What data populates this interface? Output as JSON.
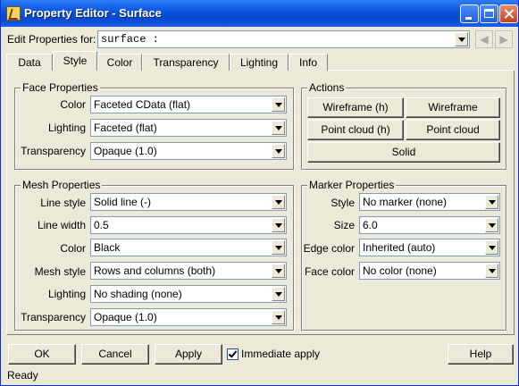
{
  "window": {
    "title": "Property Editor - Surface"
  },
  "header": {
    "edit_label": "Edit Properties for:",
    "target_value": "surface :"
  },
  "tabs": [
    "Data",
    "Style",
    "Color",
    "Transparency",
    "Lighting",
    "Info"
  ],
  "face": {
    "title": "Face Properties",
    "color_label": "Color",
    "color_value": "Faceted CData (flat)",
    "lighting_label": "Lighting",
    "lighting_value": "Faceted (flat)",
    "transparency_label": "Transparency",
    "transparency_value": "Opaque (1.0)"
  },
  "actions": {
    "title": "Actions",
    "wireframe_h": "Wireframe (h)",
    "wireframe": "Wireframe",
    "pointcloud_h": "Point cloud (h)",
    "pointcloud": "Point cloud",
    "solid": "Solid"
  },
  "mesh": {
    "title": "Mesh Properties",
    "linestyle_label": "Line style",
    "linestyle_value": "Solid line (-)",
    "linewidth_label": "Line width",
    "linewidth_value": "0.5",
    "color_label": "Color",
    "color_value": "Black",
    "meshstyle_label": "Mesh style",
    "meshstyle_value": "Rows and columns (both)",
    "lighting_label": "Lighting",
    "lighting_value": "No shading (none)",
    "transparency_label": "Transparency",
    "transparency_value": "Opaque (1.0)"
  },
  "marker": {
    "title": "Marker Properties",
    "style_label": "Style",
    "style_value": "No marker (none)",
    "size_label": "Size",
    "size_value": "6.0",
    "edgecolor_label": "Edge color",
    "edgecolor_value": "Inherited (auto)",
    "facecolor_label": "Face color",
    "facecolor_value": "No color (none)"
  },
  "footer": {
    "ok": "OK",
    "cancel": "Cancel",
    "apply": "Apply",
    "immediate": "Immediate apply",
    "immediate_checked": true,
    "help": "Help"
  },
  "status": {
    "text": "Ready"
  }
}
